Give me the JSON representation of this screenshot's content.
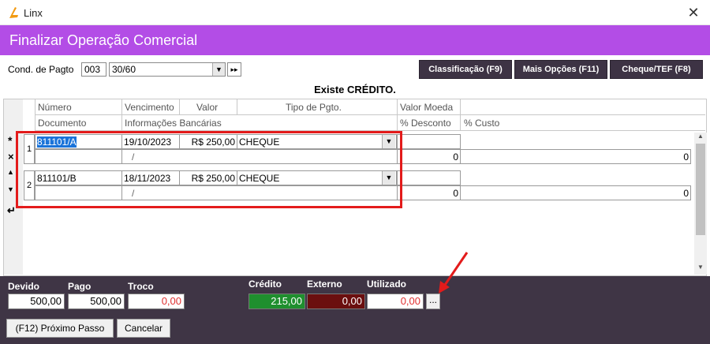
{
  "window": {
    "title": "Linx",
    "close_symbol": "✕"
  },
  "header": {
    "title": "Finalizar Operação Comercial"
  },
  "cond": {
    "label": "Cond. de Pagto",
    "code": "003",
    "value": "30/60",
    "dropdown_symbol": "▼",
    "next_symbol": "▸▸"
  },
  "buttons": {
    "classificacao": "Classificação (F9)",
    "mais_opcoes": "Mais Opções (F11)",
    "cheque_tef": "Cheque/TEF (F8)"
  },
  "notice": "Existe CRÉDITO.",
  "grid": {
    "header_row1": [
      "Número",
      "Vencimento",
      "Valor",
      "Tipo de Pgto.",
      "Valor Moeda"
    ],
    "header_row2": [
      "Documento",
      "Informações Bancárias",
      "% Desconto",
      "% Custo"
    ],
    "side_controls": [
      "*",
      "×",
      "▲",
      "▼",
      "↵"
    ],
    "rows": [
      {
        "index": "1",
        "numero": "811101/A",
        "vencimento": "19/10/2023",
        "valor": "R$ 250,00",
        "tipo": "CHEQUE",
        "info": "/",
        "desconto": "0",
        "custo": "0"
      },
      {
        "index": "2",
        "numero": "811101/B",
        "vencimento": "18/11/2023",
        "valor": "R$ 250,00",
        "tipo": "CHEQUE",
        "info": "/",
        "desconto": "0",
        "custo": "0"
      }
    ],
    "scroll_up": "▲",
    "scroll_down": "▼"
  },
  "totals": {
    "devido_label": "Devido",
    "devido": "500,00",
    "pago_label": "Pago",
    "pago": "500,00",
    "troco_label": "Troco",
    "troco": "0,00",
    "credito_label": "Crédito",
    "credito": "215,00",
    "externo_label": "Externo",
    "externo": "0,00",
    "utilizado_label": "Utilizado",
    "utilizado": "0,00",
    "ellipsis": "..."
  },
  "footer": {
    "next_step": "(F12) Próximo Passo",
    "cancel": "Cancelar"
  },
  "colors": {
    "header": "#b34de6",
    "bottom_panel": "#3f3545",
    "credito_bg": "#1f8f2e",
    "externo_bg": "#6b0f0f",
    "highlight": "#e31b1b"
  }
}
